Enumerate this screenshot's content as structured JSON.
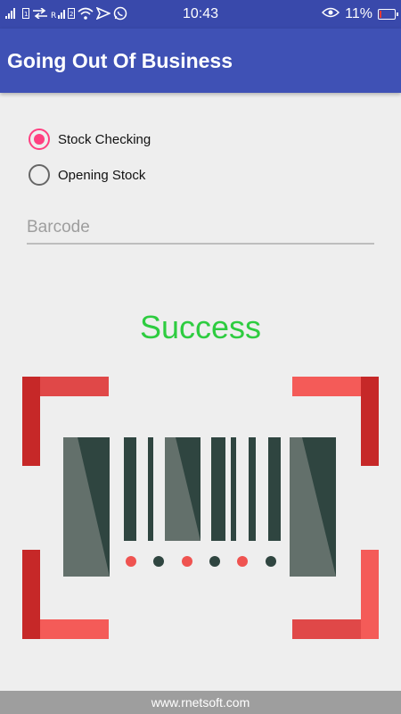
{
  "status_bar": {
    "time": "10:43",
    "battery": "11%",
    "battery_level": 0.11,
    "icons": [
      "signal-icon",
      "sim-icon",
      "data-transfer-icon",
      "signal-icon",
      "sim-icon",
      "wifi-icon",
      "send-icon",
      "whatsapp-icon",
      "eye-icon",
      "battery-icon"
    ],
    "colors": {
      "background": "#3949ab",
      "battery_low": "#e53935"
    }
  },
  "app_bar": {
    "title": "Going Out Of Business",
    "color": "#3f51b5"
  },
  "radio_group": {
    "options": [
      {
        "label": "Stock Checking",
        "checked": true
      },
      {
        "label": "Opening Stock",
        "checked": false
      }
    ],
    "accent": "#ff4081"
  },
  "barcode_field": {
    "placeholder": "Barcode",
    "value": ""
  },
  "result": {
    "text": "Success",
    "color": "#2ecc40"
  },
  "scanner_graphic": {
    "icon": "barcode-scanner-icon",
    "colors": {
      "frame": "#e53935",
      "bars": "#2f4540",
      "dot_red": "#ef5350",
      "dot_dark": "#2f4540"
    }
  },
  "footer": {
    "text": "www.rnetsoft.com"
  }
}
